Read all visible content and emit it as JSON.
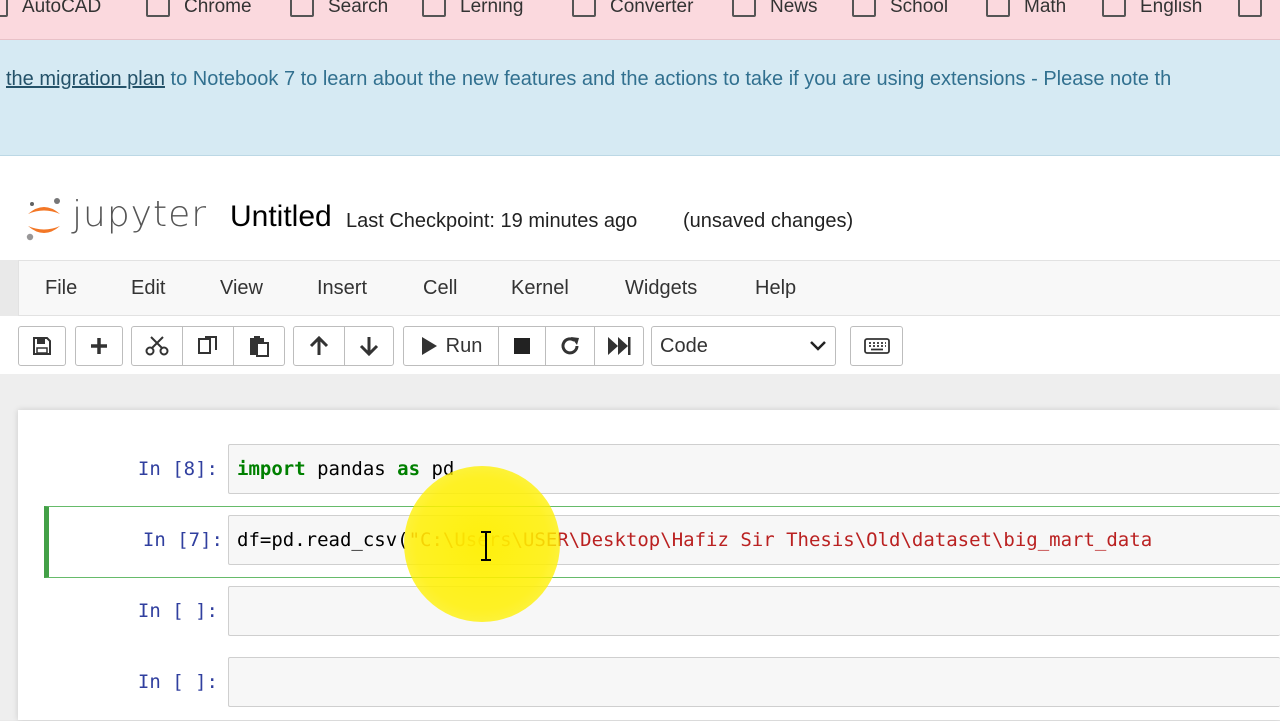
{
  "bookmarks": [
    {
      "label": "AutoCAD"
    },
    {
      "label": "Chrome"
    },
    {
      "label": "Search"
    },
    {
      "label": "Lerning"
    },
    {
      "label": "Converter"
    },
    {
      "label": "News"
    },
    {
      "label": "School"
    },
    {
      "label": "Math"
    },
    {
      "label": "English"
    }
  ],
  "banner": {
    "link_text": "the migration plan",
    "text": " to Notebook 7 to learn about the new features and the actions to take if you are using extensions - Please note th"
  },
  "header": {
    "logo_text": "jupyter",
    "notebook_title": "Untitled",
    "checkpoint": "Last Checkpoint: 19 minutes ago",
    "autosave_status": "(unsaved changes)"
  },
  "menu": [
    "File",
    "Edit",
    "View",
    "Insert",
    "Cell",
    "Kernel",
    "Widgets",
    "Help"
  ],
  "toolbar": {
    "run_label": "Run",
    "cell_type": "Code"
  },
  "cells": [
    {
      "prompt": "In [8]:",
      "kw1": "import",
      "mid": " pandas ",
      "kw2": "as",
      "end": " pd"
    },
    {
      "prompt": "In [7]:",
      "code_plain": "df=pd.read_csv(",
      "code_string": "\"C:\\Users\\USER\\Desktop\\Hafiz Sir Thesis\\Old\\dataset\\big_mart_data"
    },
    {
      "prompt": "In [ ]:"
    },
    {
      "prompt": "In [ ]:"
    }
  ],
  "colors": {
    "bookmarks_bg": "#fbd9de",
    "banner_bg": "#d6eaf3",
    "selected_cell": "#43a047",
    "prompt": "#303f9f",
    "keyword": "#008000",
    "string": "#ba2121"
  }
}
